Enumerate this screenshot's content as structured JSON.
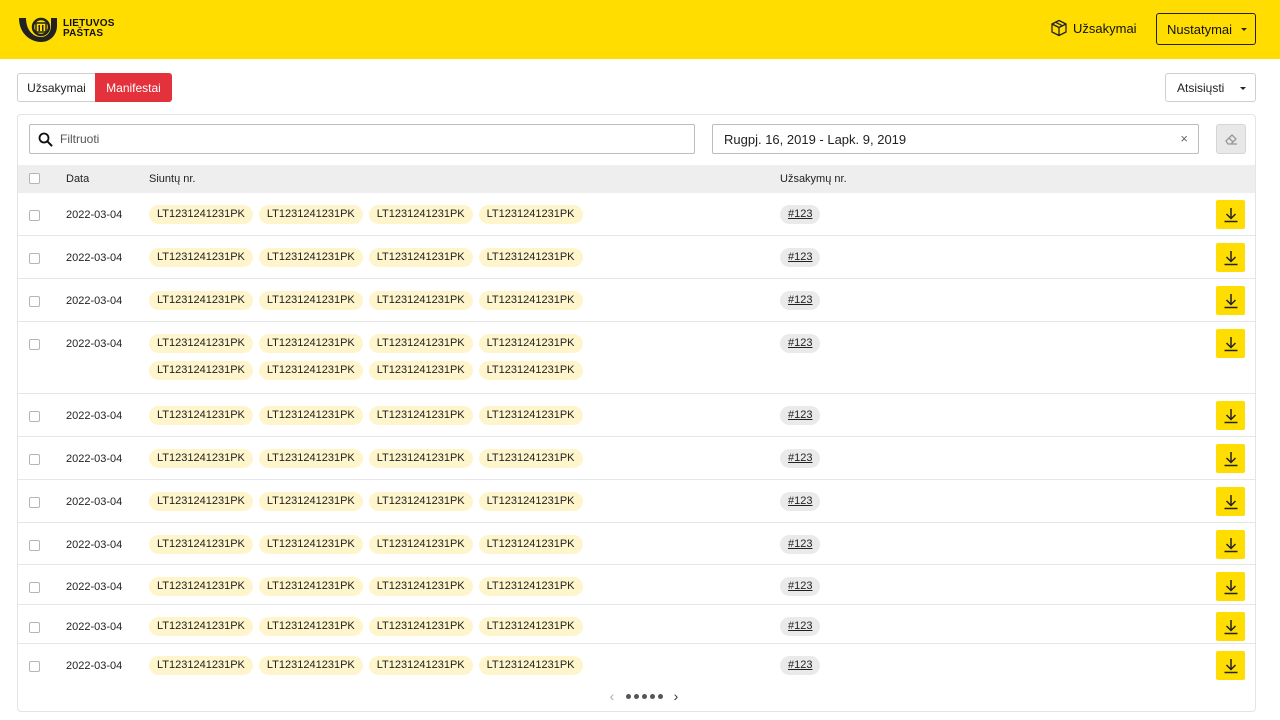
{
  "brand": {
    "name_line1": "LIETUVOS",
    "name_line2": "PAŠTAS",
    "color": "#ffdd00",
    "accent": "#e3323c"
  },
  "header": {
    "orders_label": "Užsakymai",
    "orders_icon": "box-icon",
    "settings_label": "Nustatymai"
  },
  "tabs": [
    {
      "label": "Užsakymai",
      "active": false
    },
    {
      "label": "Manifestai",
      "active": true
    }
  ],
  "download_dropdown": {
    "label": "Atsisiųsti"
  },
  "filter": {
    "placeholder": "Filtruoti",
    "value": "",
    "date_range": "Rugpj. 16, 2019 - Lapk. 9, 2019",
    "clear_symbol": "×"
  },
  "table": {
    "columns": {
      "date": "Data",
      "tracking": "Siuntų nr.",
      "orders": "Užsakymų nr."
    },
    "rows": [
      {
        "date": "2022-03-04",
        "tracking": [
          "LT1231241231PK",
          "LT1231241231PK",
          "LT1231241231PK",
          "LT1231241231PK"
        ],
        "order": "#123"
      },
      {
        "date": "2022-03-04",
        "tracking": [
          "LT1231241231PK",
          "LT1231241231PK",
          "LT1231241231PK",
          "LT1231241231PK"
        ],
        "order": "#123"
      },
      {
        "date": "2022-03-04",
        "tracking": [
          "LT1231241231PK",
          "LT1231241231PK",
          "LT1231241231PK",
          "LT1231241231PK"
        ],
        "order": "#123"
      },
      {
        "date": "2022-03-04",
        "tracking": [
          "LT1231241231PK",
          "LT1231241231PK",
          "LT1231241231PK",
          "LT1231241231PK",
          "LT1231241231PK",
          "LT1231241231PK",
          "LT1231241231PK",
          "LT1231241231PK"
        ],
        "order": "#123"
      },
      {
        "date": "2022-03-04",
        "tracking": [
          "LT1231241231PK",
          "LT1231241231PK",
          "LT1231241231PK",
          "LT1231241231PK"
        ],
        "order": "#123"
      },
      {
        "date": "2022-03-04",
        "tracking": [
          "LT1231241231PK",
          "LT1231241231PK",
          "LT1231241231PK",
          "LT1231241231PK"
        ],
        "order": "#123"
      },
      {
        "date": "2022-03-04",
        "tracking": [
          "LT1231241231PK",
          "LT1231241231PK",
          "LT1231241231PK",
          "LT1231241231PK"
        ],
        "order": "#123"
      },
      {
        "date": "2022-03-04",
        "tracking": [
          "LT1231241231PK",
          "LT1231241231PK",
          "LT1231241231PK",
          "LT1231241231PK"
        ],
        "order": "#123"
      },
      {
        "date": "2022-03-04",
        "tracking": [
          "LT1231241231PK",
          "LT1231241231PK",
          "LT1231241231PK",
          "LT1231241231PK"
        ],
        "order": "#123"
      },
      {
        "date": "2022-03-04",
        "tracking": [
          "LT1231241231PK",
          "LT1231241231PK",
          "LT1231241231PK",
          "LT1231241231PK"
        ],
        "order": "#123"
      },
      {
        "date": "2022-03-04",
        "tracking": [
          "LT1231241231PK",
          "LT1231241231PK",
          "LT1231241231PK",
          "LT1231241231PK"
        ],
        "order": "#123"
      }
    ]
  },
  "pagination": {
    "pages": 5,
    "current": 1,
    "prev": "‹",
    "next": "›"
  }
}
